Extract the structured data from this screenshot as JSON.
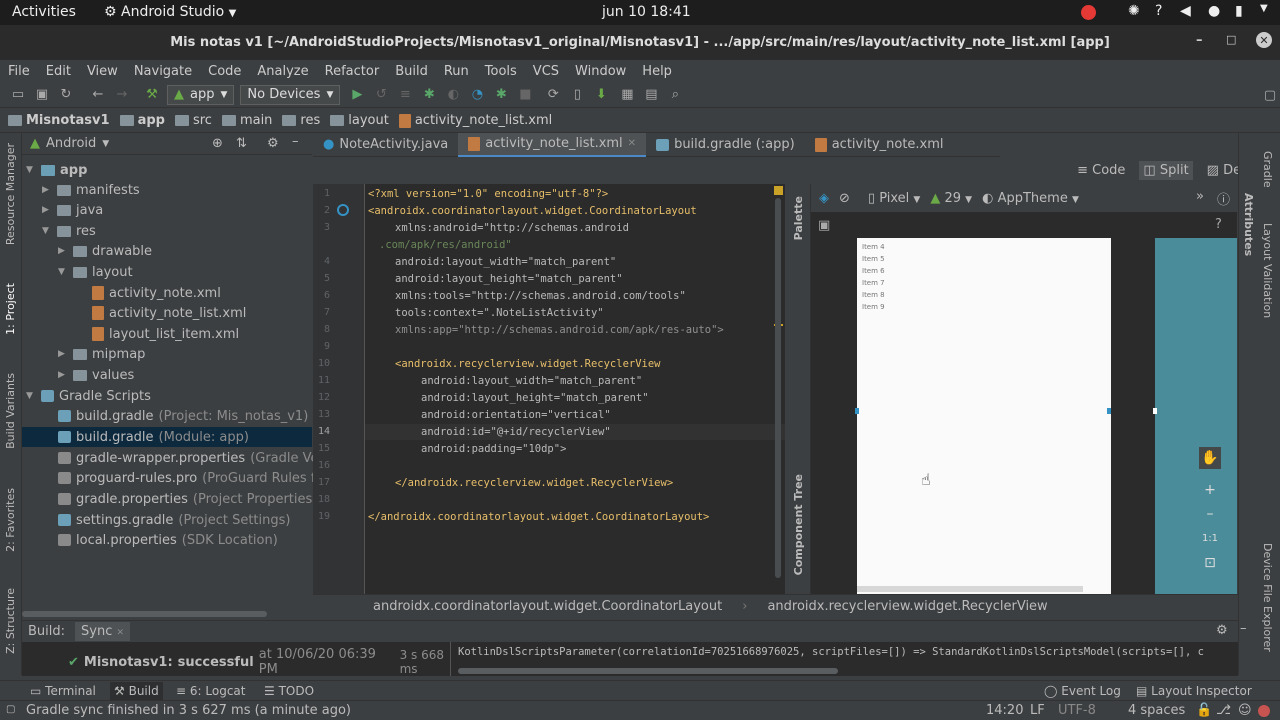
{
  "topbar": {
    "activities": "Activities",
    "app": "Android Studio",
    "datetime": "jun 10  18:41"
  },
  "window": {
    "title": "Mis notas v1 [~/AndroidStudioProjects/Misnotasv1_original/Misnotasv1] - .../app/src/main/res/layout/activity_note_list.xml [app]"
  },
  "menu": [
    "File",
    "Edit",
    "View",
    "Navigate",
    "Code",
    "Analyze",
    "Refactor",
    "Build",
    "Run",
    "Tools",
    "VCS",
    "Window",
    "Help"
  ],
  "toolbar": {
    "module": "app",
    "device": "No Devices"
  },
  "breadcrumb": [
    "Misnotasv1",
    "app",
    "src",
    "main",
    "res",
    "layout",
    "activity_note_list.xml"
  ],
  "project": {
    "view": "Android",
    "items": [
      {
        "label": "app",
        "extra": ""
      },
      {
        "label": "manifests",
        "extra": ""
      },
      {
        "label": "java",
        "extra": ""
      },
      {
        "label": "res",
        "extra": ""
      },
      {
        "label": "drawable",
        "extra": ""
      },
      {
        "label": "layout",
        "extra": ""
      },
      {
        "label": "activity_note.xml",
        "extra": ""
      },
      {
        "label": "activity_note_list.xml",
        "extra": ""
      },
      {
        "label": "layout_list_item.xml",
        "extra": ""
      },
      {
        "label": "mipmap",
        "extra": ""
      },
      {
        "label": "values",
        "extra": ""
      },
      {
        "label": "Gradle Scripts",
        "extra": ""
      },
      {
        "label": "build.gradle",
        "extra": "(Project: Mis_notas_v1)"
      },
      {
        "label": "build.gradle",
        "extra": "(Module: app)"
      },
      {
        "label": "gradle-wrapper.properties",
        "extra": "(Gradle Ve"
      },
      {
        "label": "proguard-rules.pro",
        "extra": "(ProGuard Rules f"
      },
      {
        "label": "gradle.properties",
        "extra": "(Project Properties"
      },
      {
        "label": "settings.gradle",
        "extra": "(Project Settings)"
      },
      {
        "label": "local.properties",
        "extra": "(SDK Location)"
      }
    ]
  },
  "stripes": {
    "resource_manager": "Resource Manager",
    "project": "1: Project",
    "build_variants": "Build Variants",
    "favorites": "2: Favorites",
    "structure": "Z: Structure",
    "gradle": "Gradle",
    "layout_validation": "Layout Validation",
    "device_file_explorer": "Device File Explorer",
    "palette": "Palette",
    "attributes": "Attributes",
    "component_tree": "Component Tree"
  },
  "tabs": [
    "NoteActivity.java",
    "activity_note_list.xml",
    "build.gradle (:app)",
    "activity_note.xml"
  ],
  "modes": {
    "code": "Code",
    "split": "Split",
    "design": "Design"
  },
  "code": {
    "line_numbers": [
      "1",
      "2",
      "3",
      "",
      "4",
      "5",
      "6",
      "7",
      "8",
      "9",
      "10",
      "11",
      "12",
      "13",
      "14",
      "15",
      "16",
      "17",
      "18",
      "19"
    ],
    "l1": "<?xml version=\"1.0\" encoding=\"utf-8\"?>",
    "l2": "<androidx.coordinatorlayout.widget.CoordinatorLayout",
    "l3a": "xmlns:android=\"http://schemas.android",
    "l3b": ".com/apk/res/android\"",
    "l4": "android:layout_width=\"match_parent\"",
    "l5": "android:layout_height=\"match_parent\"",
    "l6": "xmlns:tools=\"http://schemas.android.com/tools\"",
    "l7": "tools:context=\".NoteListActivity\"",
    "l8": "xmlns:app=\"http://schemas.android.com/apk/res-auto\">",
    "l10": "<androidx.recyclerview.widget.RecyclerView",
    "l11": "android:layout_width=\"match_parent\"",
    "l12": "android:layout_height=\"match_parent\"",
    "l13": "android:orientation=\"vertical\"",
    "l14": "android:id=\"@+id/recyclerView\"",
    "l15": "android:padding=\"10dp\">",
    "l17": "</androidx.recyclerview.widget.RecyclerView>",
    "l19": "</androidx.coordinatorlayout.widget.CoordinatorLayout>"
  },
  "design": {
    "device": "Pixel",
    "api": "29",
    "theme": "AppTheme",
    "items": [
      "Item 4",
      "Item 5",
      "Item 6",
      "Item 7",
      "Item 8",
      "Item 9"
    ],
    "zoom_reset": "1:1"
  },
  "editor_crumb": [
    "androidx.coordinatorlayout.widget.CoordinatorLayout",
    "androidx.recyclerview.widget.RecyclerView"
  ],
  "build": {
    "label": "Build:",
    "tab": "Sync",
    "result_title": "Misnotasv1:",
    "result_status": "successful",
    "result_time": "at 10/06/20 06:39 PM",
    "duration": "3 s 668 ms",
    "log": "KotlinDslScriptsParameter(correlationId=70251668976025, scriptFiles=[]) => StandardKotlinDslScriptsModel(scripts=[], c"
  },
  "bottom_tabs": [
    "Terminal",
    "Build",
    "6: Logcat",
    "TODO"
  ],
  "bottom_right": [
    "Event Log",
    "Layout Inspector"
  ],
  "status": {
    "message": "Gradle sync finished in 3 s 627 ms (a minute ago)",
    "position": "14:20",
    "line_sep": "LF",
    "encoding": "UTF-8",
    "indent": "4 spaces"
  }
}
